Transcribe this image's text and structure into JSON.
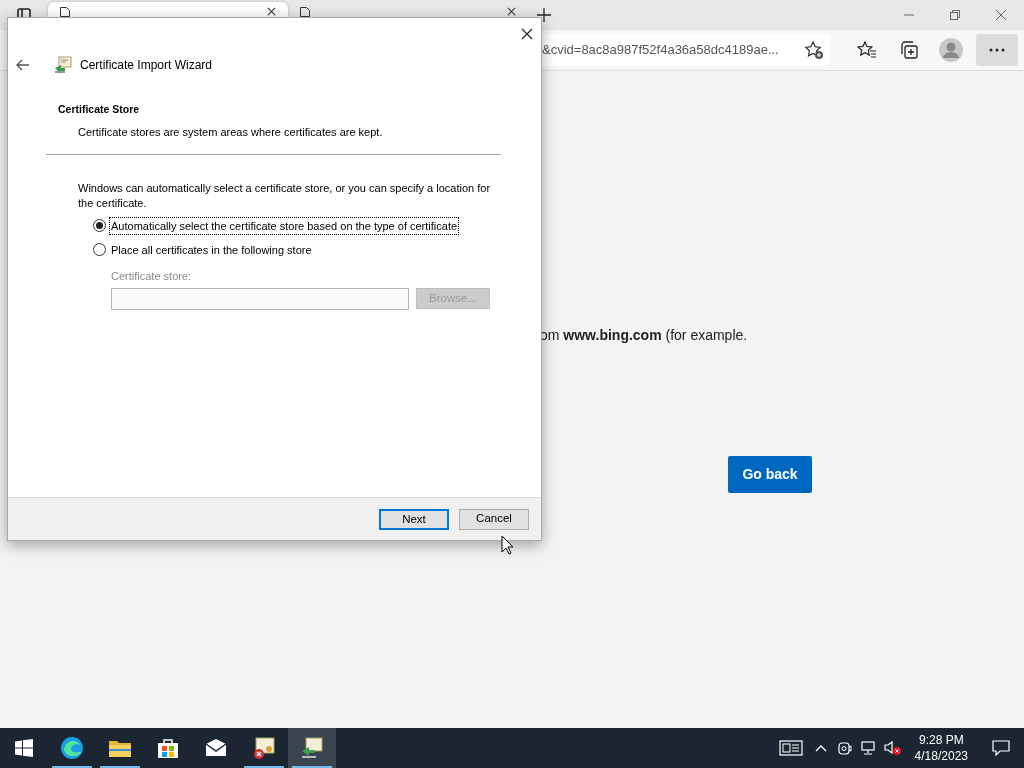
{
  "browser": {
    "tabs": [
      {
        "selected": true
      },
      {
        "selected": false
      }
    ],
    "address": "&cvid=8ac8a987f52f4a36a58dc4189ae...",
    "content": {
      "text": "om **www.bing.com** (for example.",
      "button": "Go back"
    }
  },
  "dialog": {
    "title": "Certificate Import Wizard",
    "heading": "Certificate Store",
    "subheading": "Certificate stores are system areas where certificates are kept.",
    "intro": "Windows can automatically select a certificate store, or you can specify a location for the certificate.",
    "options": [
      {
        "label": "Automatically select the certificate store based on the type of certificate",
        "selected": true
      },
      {
        "label": "Place all certificates in the following store",
        "selected": false
      }
    ],
    "store": {
      "label": "Certificate store:",
      "button": "Browse...",
      "disabled": true
    },
    "buttons": [
      {
        "label": "Next",
        "default": true
      },
      {
        "label": "Cancel",
        "default": false
      }
    ]
  },
  "taskbar": {
    "apps": [
      {
        "kind": "edge",
        "running": true,
        "selected": false
      },
      {
        "kind": "folder",
        "running": true,
        "selected": false
      },
      {
        "kind": "store",
        "running": false,
        "selected": false
      },
      {
        "kind": "mail",
        "running": false,
        "selected": false
      },
      {
        "kind": "cert-error",
        "running": true,
        "selected": false
      },
      {
        "kind": "cert-import",
        "running": true,
        "selected": true
      }
    ],
    "time": "9:28 PM",
    "date": "4/18/2023"
  }
}
